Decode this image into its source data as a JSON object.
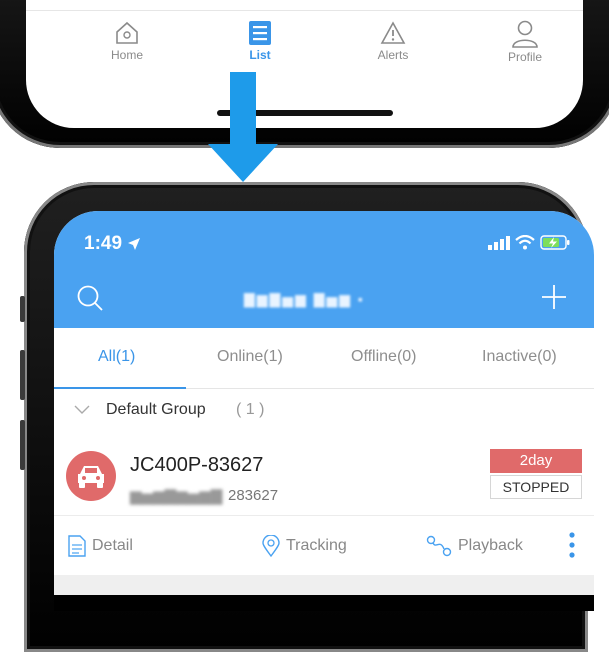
{
  "bottom_tabs": [
    {
      "label": "Home",
      "icon": "home-icon"
    },
    {
      "label": "List",
      "icon": "list-icon"
    },
    {
      "label": "Alerts",
      "icon": "alert-icon"
    },
    {
      "label": "Profile",
      "icon": "profile-icon"
    }
  ],
  "status_bar": {
    "time": "1:49"
  },
  "filters": [
    "All(1)",
    "Online(1)",
    "Offline(0)",
    "Inactive(0)"
  ],
  "group": {
    "name": "Default Group",
    "count": "( 1 )"
  },
  "device": {
    "name": "JC400P-83627",
    "imei_suffix": "283627",
    "duration": "2day",
    "status": "STOPPED"
  },
  "actions": {
    "detail": "Detail",
    "tracking": "Tracking",
    "playback": "Playback"
  },
  "colors": {
    "accent": "#3a95e8",
    "header": "#4aa2f1",
    "alert_red": "#e06a6a",
    "arrow": "#1e9bea"
  }
}
